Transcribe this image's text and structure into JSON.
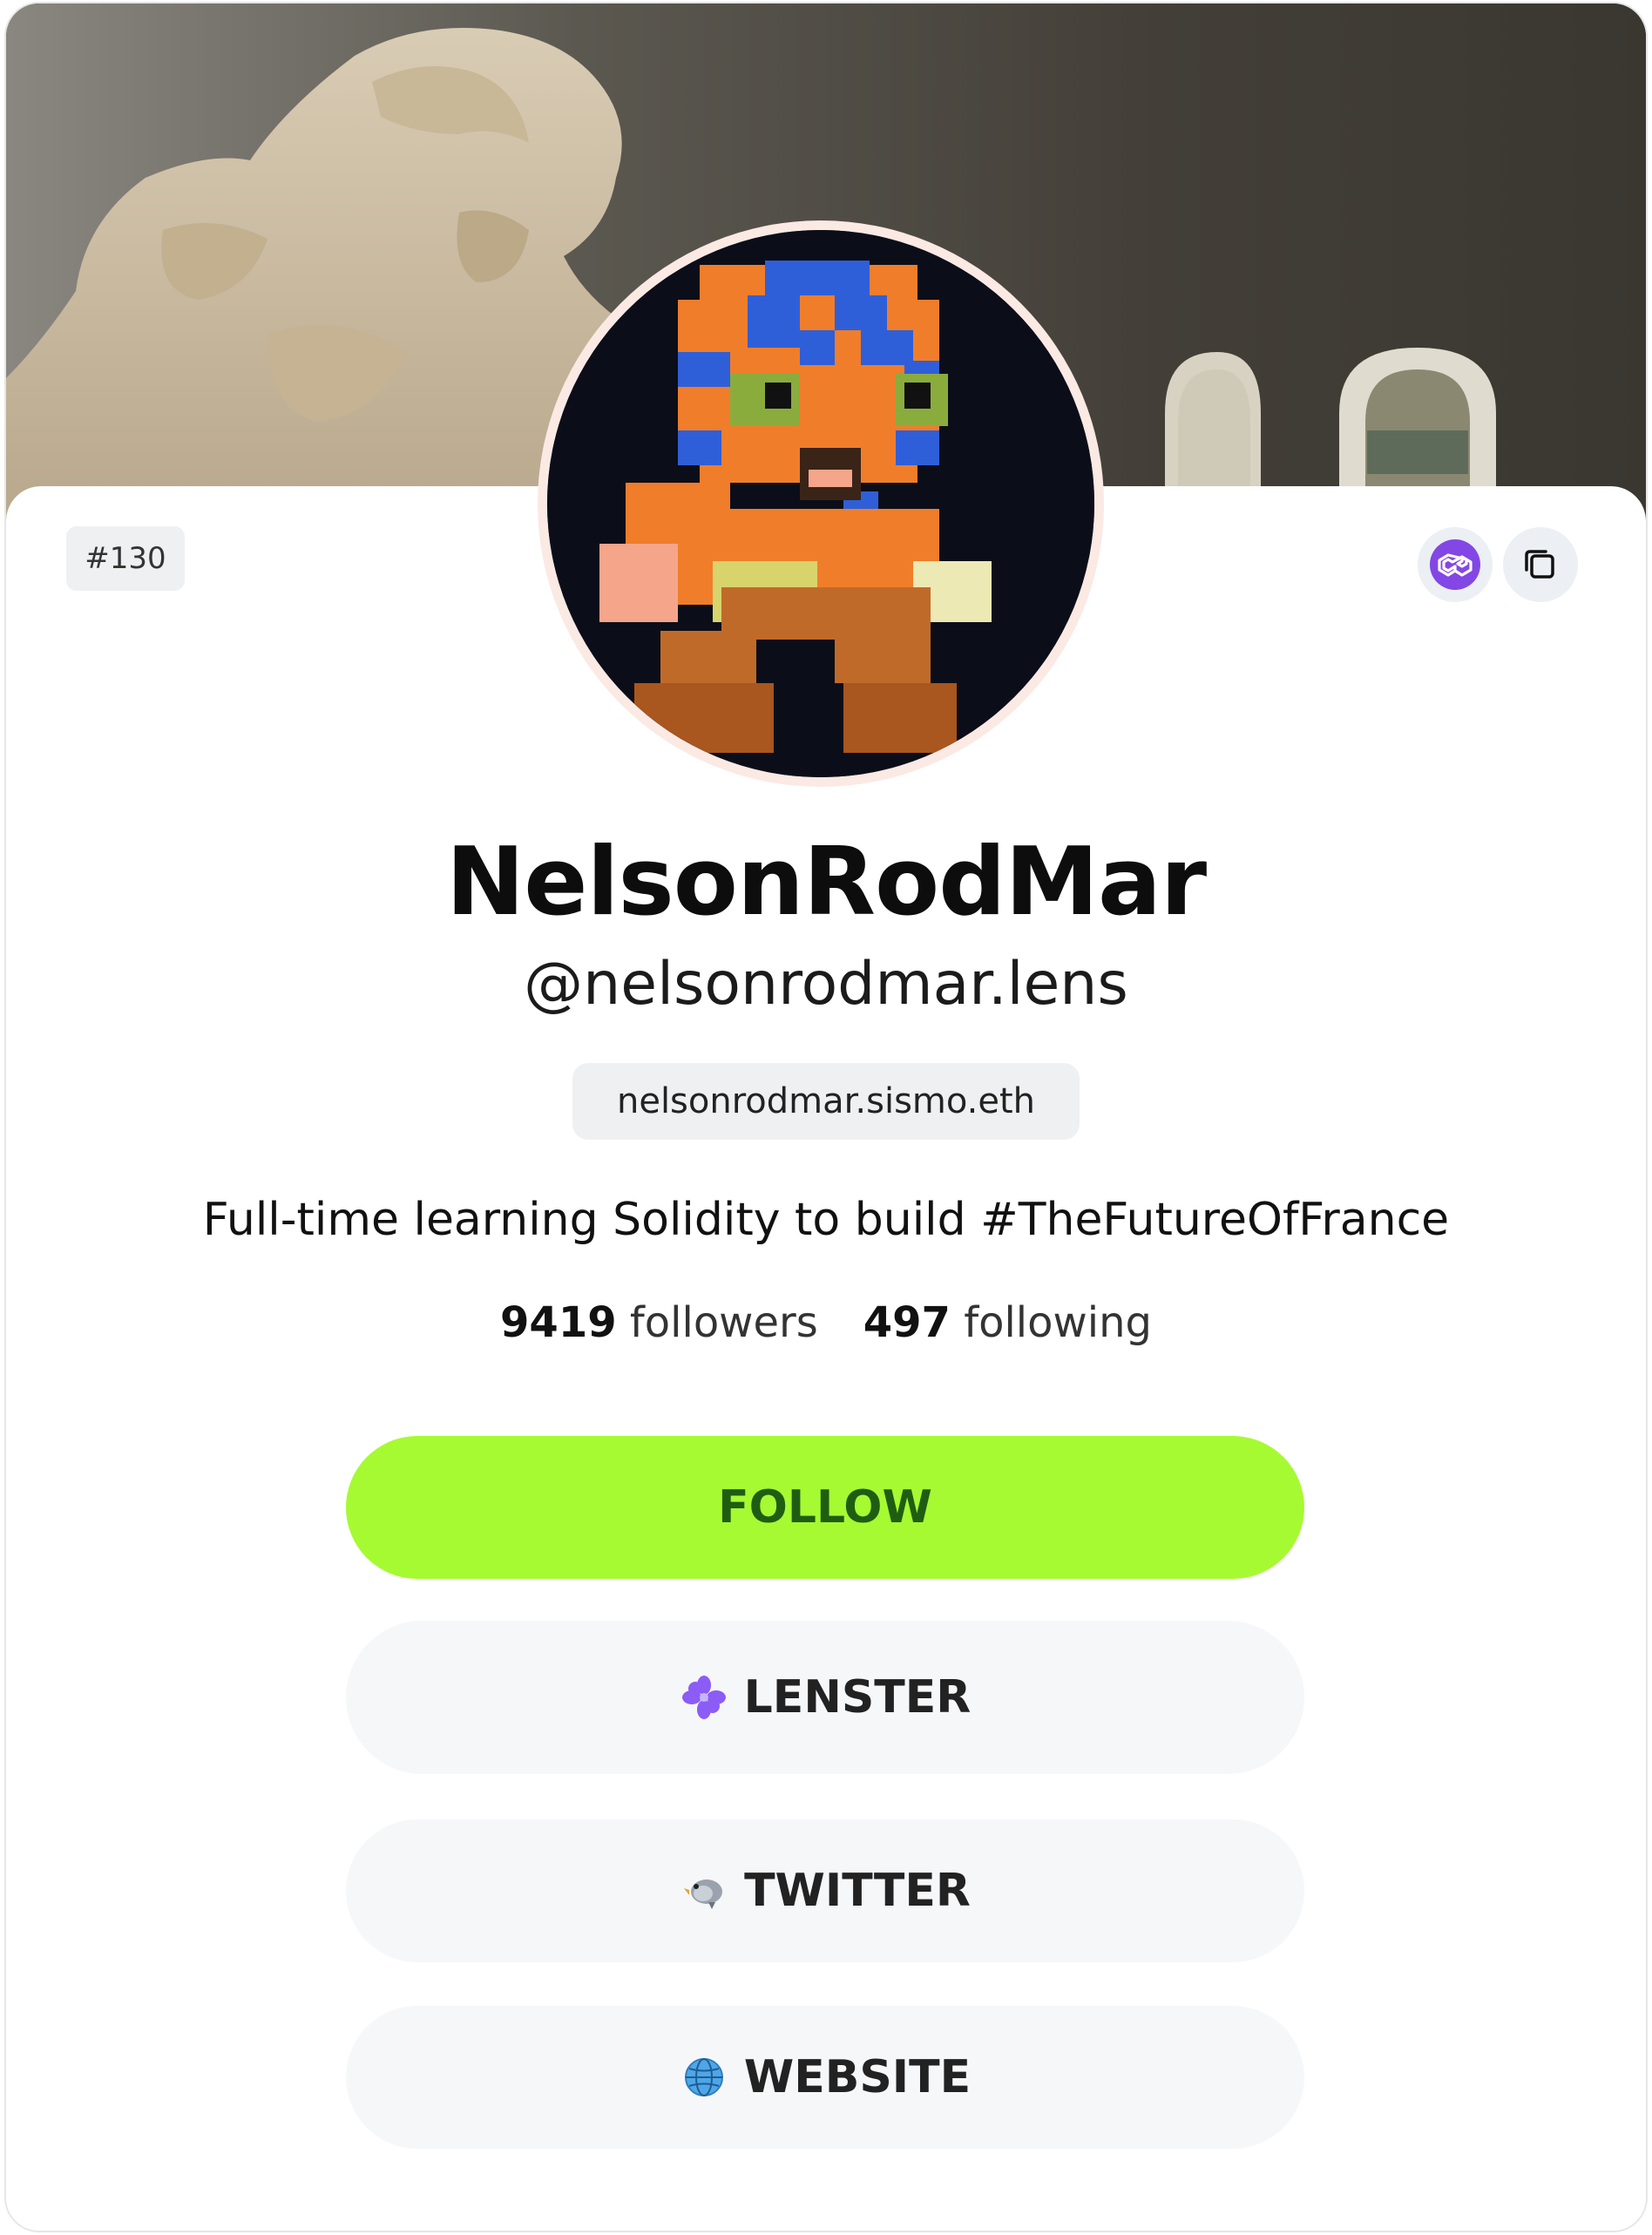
{
  "profile": {
    "token_id": "#130",
    "display_name": "NelsonRodMar",
    "handle": "@nelsonrodmar.lens",
    "ens": "nelsonrodmar.sismo.eth",
    "bio": "Full-time learning Solidity to build #TheFutureOfFrance",
    "followers_count": "9419",
    "followers_label": "followers",
    "following_count": "497",
    "following_label": "following"
  },
  "icons": {
    "network": "polygon-icon",
    "copy": "copy-icon",
    "lenster": "lenster-flower-icon",
    "twitter": "bird-icon",
    "website": "globe-icon"
  },
  "buttons": {
    "follow": "FOLLOW",
    "lenster": "LENSTER",
    "twitter": "TWITTER",
    "website": "WEBSITE"
  },
  "colors": {
    "follow_bg": "#a6fa32",
    "follow_text": "#1f5e12",
    "polygon": "#8247e5",
    "lenster": "#8b5cf6"
  }
}
